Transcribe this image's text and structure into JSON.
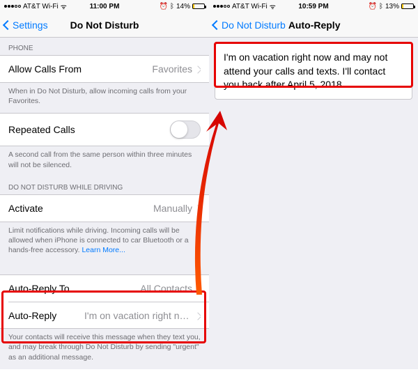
{
  "left": {
    "status": {
      "carrier": "AT&T Wi-Fi",
      "time": "11:00 PM",
      "battery": "14%",
      "bt": "✱"
    },
    "nav": {
      "back": "Settings",
      "title": "Do Not Disturb"
    },
    "groups": {
      "phone_header": "PHONE",
      "allow_calls": {
        "label": "Allow Calls From",
        "value": "Favorites"
      },
      "allow_calls_footer": "When in Do Not Disturb, allow incoming calls from your Favorites.",
      "repeated": {
        "label": "Repeated Calls"
      },
      "repeated_footer": "A second call from the same person within three minutes will not be silenced.",
      "driving_header": "DO NOT DISTURB WHILE DRIVING",
      "activate": {
        "label": "Activate",
        "value": "Manually"
      },
      "activate_footer": "Limit notifications while driving. Incoming calls will be allowed when iPhone is connected to car Bluetooth or a hands-free accessory. ",
      "learn_more": "Learn More...",
      "auto_reply_to": {
        "label": "Auto-Reply To",
        "value": "All Contacts"
      },
      "auto_reply": {
        "label": "Auto-Reply",
        "value": "I'm on vacation right now an…"
      },
      "auto_reply_footer": "Your contacts will receive this message when they text you, and may break through Do Not Disturb by sending \"urgent\" as an additional message."
    }
  },
  "right": {
    "status": {
      "carrier": "AT&T Wi-Fi",
      "time": "10:59 PM",
      "battery": "13%",
      "bt": "✱"
    },
    "nav": {
      "back": "Do Not Disturb",
      "title": "Auto-Reply"
    },
    "message": "I'm on vacation right now and may not attend your calls and texts. I'll contact you back after April 5, 2018."
  },
  "icons": {
    "alarm": "⏰",
    "wifi": "ᯤ",
    "bt": "ᛒ"
  }
}
